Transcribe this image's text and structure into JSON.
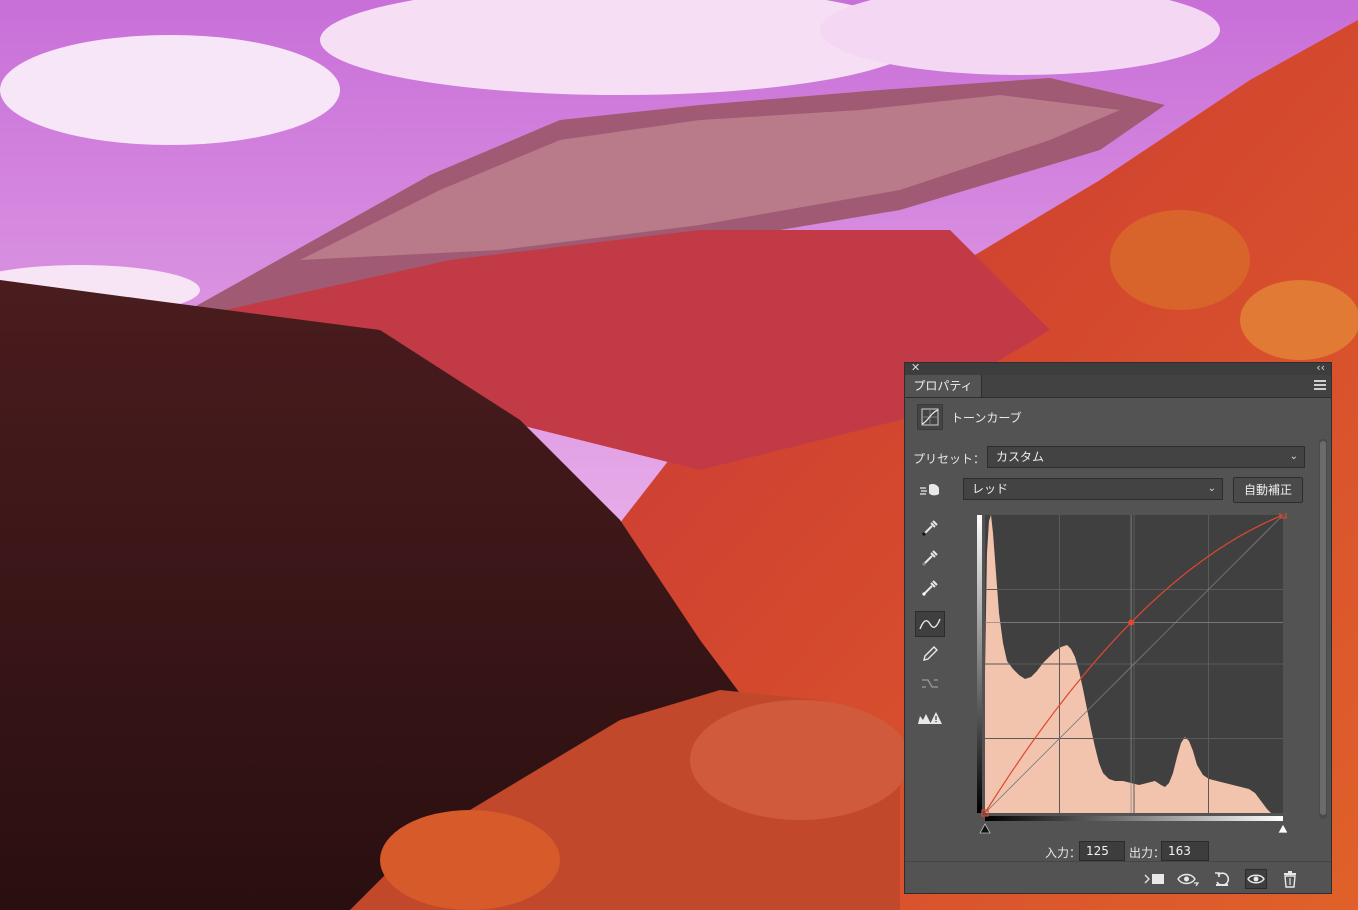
{
  "panel": {
    "tab_label": "プロパティ",
    "adjustment_title": "トーンカーブ",
    "preset_label": "プリセット：",
    "preset_value": "カスタム",
    "channel_value": "レッド",
    "auto_button_label": "自動補正",
    "input_label": "入力：",
    "input_value": "125",
    "output_label": "出力：",
    "output_value": "163"
  },
  "curve": {
    "channel_color": "#e0472f",
    "histogram_color": "#f2c3ad",
    "graph_bg": "#404040",
    "control_points": [
      {
        "input": 0,
        "output": 0
      },
      {
        "input": 125,
        "output": 163
      },
      {
        "input": 255,
        "output": 255
      }
    ]
  },
  "icons": {
    "tools": [
      "on-image-adjust-icon",
      "sample-black-eyedropper-icon",
      "sample-gray-eyedropper-icon",
      "sample-white-eyedropper-icon",
      "curve-points-icon",
      "pencil-icon",
      "smooth-curve-icon",
      "clipping-warning-icon"
    ],
    "footer": [
      "clip-to-layer-icon",
      "view-previous-state-icon",
      "reset-icon",
      "visibility-icon",
      "trash-icon"
    ]
  }
}
